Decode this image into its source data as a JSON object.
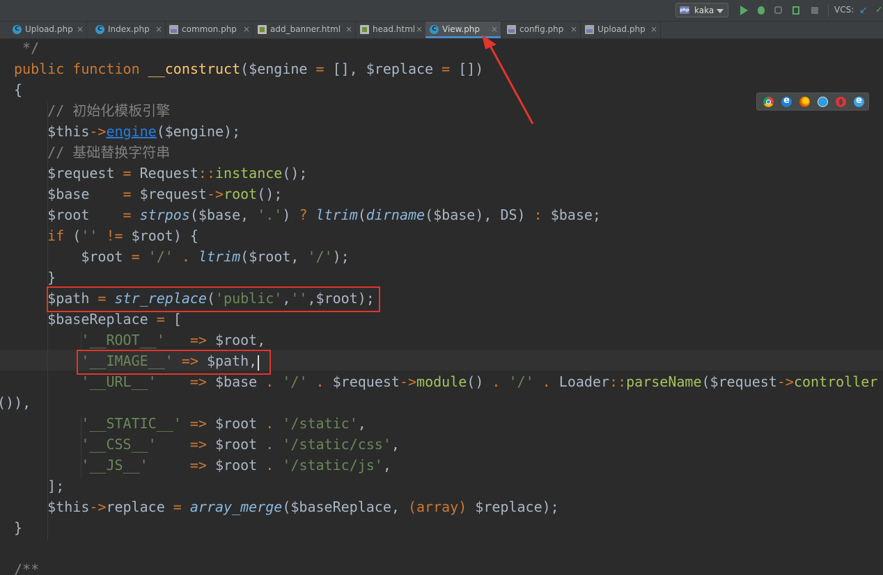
{
  "toolbar": {
    "run_config": "kaka",
    "vcs_label": "VCS:",
    "icons": [
      "php-icon",
      "run-icon",
      "debug-icon",
      "coverage-icon",
      "profile-icon",
      "stop-icon",
      "vcs-update-icon",
      "vcs-commit-icon"
    ]
  },
  "tabs": [
    {
      "label": "Upload.php",
      "icon": "class-icon",
      "active": false
    },
    {
      "label": "Index.php",
      "icon": "class-icon",
      "active": false
    },
    {
      "label": "common.php",
      "icon": "php-file-icon",
      "active": false
    },
    {
      "label": "add_banner.html",
      "icon": "html-file-icon",
      "active": false
    },
    {
      "label": "head.html",
      "icon": "html-file-icon",
      "active": false
    },
    {
      "label": "View.php",
      "icon": "class-icon",
      "active": true
    },
    {
      "label": "config.php",
      "icon": "php-file-icon",
      "active": false
    },
    {
      "label": "Upload.php",
      "icon": "php-file-icon",
      "active": false
    }
  ],
  "tab_close": "×",
  "browser_icons": [
    "chrome-icon",
    "edge-icon",
    "firefox-icon",
    "safari-icon",
    "opera-icon",
    "ie-icon"
  ],
  "code": {
    "lines": [
      [
        [
          "tok-cm2",
          " */"
        ]
      ],
      [
        [
          "tok-kw",
          "public function "
        ],
        [
          "tok-fn",
          "__construct"
        ],
        [
          "tok-plain",
          "($engine "
        ],
        [
          "tok-op",
          "="
        ],
        [
          "tok-plain",
          " [], $replace "
        ],
        [
          "tok-op",
          "="
        ],
        [
          "tok-plain",
          " [])"
        ]
      ],
      [
        [
          "tok-plain",
          "{"
        ]
      ],
      [
        [
          "tok-cm2",
          "    // 初始化模板引擎"
        ]
      ],
      [
        [
          "tok-plain",
          "    $this"
        ],
        [
          "tok-op",
          "->"
        ],
        [
          "tok-link",
          "engine"
        ],
        [
          "tok-plain",
          "($engine);"
        ]
      ],
      [
        [
          "tok-cm2",
          "    // 基础替换字符串"
        ]
      ],
      [
        [
          "tok-plain",
          "    $request "
        ],
        [
          "tok-op",
          "="
        ],
        [
          "tok-plain",
          " Request"
        ],
        [
          "tok-op",
          "::"
        ],
        [
          "tok-method",
          "instance"
        ],
        [
          "tok-plain",
          "();"
        ]
      ],
      [
        [
          "tok-plain",
          "    $base    "
        ],
        [
          "tok-op",
          "="
        ],
        [
          "tok-plain",
          " $request"
        ],
        [
          "tok-op",
          "->"
        ],
        [
          "tok-method",
          "root"
        ],
        [
          "tok-plain",
          "();"
        ]
      ],
      [
        [
          "tok-plain",
          "    $root    "
        ],
        [
          "tok-op",
          "="
        ],
        [
          "tok-plain",
          " "
        ],
        [
          "tok-builtin",
          "strpos"
        ],
        [
          "tok-plain",
          "($base, "
        ],
        [
          "tok-str",
          "'.'"
        ],
        [
          "tok-plain",
          ") "
        ],
        [
          "tok-op",
          "?"
        ],
        [
          "tok-plain",
          " "
        ],
        [
          "tok-builtin",
          "ltrim"
        ],
        [
          "tok-plain",
          "("
        ],
        [
          "tok-builtin",
          "dirname"
        ],
        [
          "tok-plain",
          "($base), DS) "
        ],
        [
          "tok-op",
          ":"
        ],
        [
          "tok-plain",
          " $base;"
        ]
      ],
      [
        [
          "tok-kw",
          "    if"
        ],
        [
          "tok-plain",
          " ("
        ],
        [
          "tok-str",
          "''"
        ],
        [
          "tok-plain",
          " "
        ],
        [
          "tok-op",
          "!="
        ],
        [
          "tok-plain",
          " $root) {"
        ]
      ],
      [
        [
          "tok-plain",
          "        $root "
        ],
        [
          "tok-op",
          "="
        ],
        [
          "tok-plain",
          " "
        ],
        [
          "tok-str",
          "'/'"
        ],
        [
          "tok-plain",
          " "
        ],
        [
          "tok-op",
          "."
        ],
        [
          "tok-plain",
          " "
        ],
        [
          "tok-builtin",
          "ltrim"
        ],
        [
          "tok-plain",
          "($root, "
        ],
        [
          "tok-str",
          "'/'"
        ],
        [
          "tok-plain",
          ");"
        ]
      ],
      [
        [
          "tok-plain",
          "    }"
        ]
      ],
      [
        [
          "tok-plain",
          "    $path "
        ],
        [
          "tok-op",
          "="
        ],
        [
          "tok-plain",
          " "
        ],
        [
          "tok-builtin",
          "str_replace"
        ],
        [
          "tok-plain",
          "("
        ],
        [
          "tok-str",
          "'public'"
        ],
        [
          "tok-plain",
          ","
        ],
        [
          "tok-str",
          "''"
        ],
        [
          "tok-plain",
          ",$root);"
        ]
      ],
      [
        [
          "tok-plain",
          "    $baseReplace "
        ],
        [
          "tok-op",
          "="
        ],
        [
          "tok-plain",
          " ["
        ]
      ],
      [
        [
          "tok-str",
          "        '__ROOT__'"
        ],
        [
          "tok-plain",
          "   "
        ],
        [
          "tok-op",
          "=>"
        ],
        [
          "tok-plain",
          " $root,"
        ]
      ],
      [
        [
          "tok-str",
          "        '__IMAGE__'"
        ],
        [
          "tok-plain",
          " "
        ],
        [
          "tok-op",
          "=>"
        ],
        [
          "tok-plain",
          " $path,"
        ]
      ],
      [
        [
          "tok-str",
          "        '__URL__'"
        ],
        [
          "tok-plain",
          "    "
        ],
        [
          "tok-op",
          "=>"
        ],
        [
          "tok-plain",
          " $base "
        ],
        [
          "tok-op",
          "."
        ],
        [
          "tok-plain",
          " "
        ],
        [
          "tok-str",
          "'/'"
        ],
        [
          "tok-plain",
          " "
        ],
        [
          "tok-op",
          "."
        ],
        [
          "tok-plain",
          " $request"
        ],
        [
          "tok-op",
          "->"
        ],
        [
          "tok-method",
          "module"
        ],
        [
          "tok-plain",
          "() "
        ],
        [
          "tok-op",
          "."
        ],
        [
          "tok-plain",
          " "
        ],
        [
          "tok-str",
          "'/'"
        ],
        [
          "tok-plain",
          " "
        ],
        [
          "tok-op",
          "."
        ],
        [
          "tok-plain",
          " Loader"
        ],
        [
          "tok-op",
          "::"
        ],
        [
          "tok-method",
          "parseName"
        ],
        [
          "tok-plain",
          "($request"
        ],
        [
          "tok-op",
          "->"
        ],
        [
          "tok-method",
          "controller"
        ]
      ],
      [
        [
          "tok-plain",
          "()),"
        ]
      ],
      [
        [
          "tok-str",
          "        '__STATIC__'"
        ],
        [
          "tok-plain",
          " "
        ],
        [
          "tok-op",
          "=>"
        ],
        [
          "tok-plain",
          " $root "
        ],
        [
          "tok-op",
          "."
        ],
        [
          "tok-plain",
          " "
        ],
        [
          "tok-str",
          "'/static'"
        ],
        [
          "tok-plain",
          ","
        ]
      ],
      [
        [
          "tok-str",
          "        '__CSS__'"
        ],
        [
          "tok-plain",
          "    "
        ],
        [
          "tok-op",
          "=>"
        ],
        [
          "tok-plain",
          " $root "
        ],
        [
          "tok-op",
          "."
        ],
        [
          "tok-plain",
          " "
        ],
        [
          "tok-str",
          "'/static/css'"
        ],
        [
          "tok-plain",
          ","
        ]
      ],
      [
        [
          "tok-str",
          "        '__JS__'"
        ],
        [
          "tok-plain",
          "     "
        ],
        [
          "tok-op",
          "=>"
        ],
        [
          "tok-plain",
          " $root "
        ],
        [
          "tok-op",
          "."
        ],
        [
          "tok-plain",
          " "
        ],
        [
          "tok-str",
          "'/static/js'"
        ],
        [
          "tok-plain",
          ","
        ]
      ],
      [
        [
          "tok-plain",
          "    ];"
        ]
      ],
      [
        [
          "tok-plain",
          "    $this"
        ],
        [
          "tok-op",
          "->"
        ],
        [
          "tok-plain",
          "replace "
        ],
        [
          "tok-op",
          "="
        ],
        [
          "tok-plain",
          " "
        ],
        [
          "tok-builtin",
          "array_merge"
        ],
        [
          "tok-plain",
          "($baseReplace, "
        ],
        [
          "tok-keyword-array",
          "(array)"
        ],
        [
          "tok-plain",
          " $replace);"
        ]
      ],
      [
        [
          "tok-plain",
          "}"
        ]
      ],
      [
        [
          "tok-plain",
          ""
        ]
      ],
      [
        [
          "tok-cm2",
          "/**"
        ]
      ]
    ]
  },
  "colors": {
    "background": "#2b2b2b",
    "keyword": "#cc7832",
    "function": "#ffc66d",
    "string": "#6a8759",
    "comment": "#808080",
    "annotation": "#e2352c",
    "active_tab_underline": "#4a88c7"
  }
}
